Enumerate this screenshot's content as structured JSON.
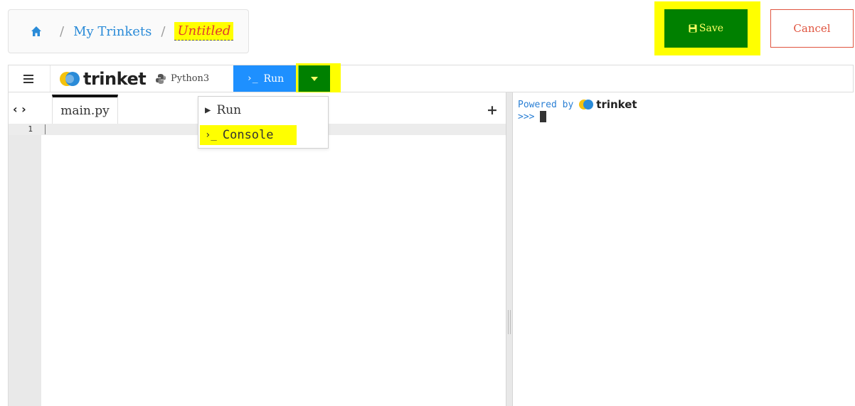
{
  "breadcrumb": {
    "home_icon": "home-icon",
    "separator": "/",
    "my_trinkets": "My Trinkets",
    "title": "Untitled"
  },
  "actions": {
    "save_label": "Save",
    "save_icon": "floppy-disk-icon",
    "cancel_label": "Cancel"
  },
  "toolbar": {
    "menu_icon": "hamburger-icon",
    "brand": "trinket",
    "language": "Python3",
    "run_prompt": "›_",
    "run_label": "Run",
    "dropdown_icon": "caret-down-icon"
  },
  "editor": {
    "code_toggle": "‹ ›",
    "file_tab": "main.py",
    "add_file": "+",
    "line_numbers": [
      "1"
    ]
  },
  "run_menu": {
    "items": [
      {
        "icon": "▶",
        "label": "Run"
      },
      {
        "icon": "›_",
        "label": "Console"
      }
    ]
  },
  "console": {
    "powered_by": "Powered by",
    "brand": "trinket",
    "prompt": ">>>"
  },
  "colors": {
    "highlight": "#ffff00",
    "save_bg": "#008000",
    "run_bg": "#1e90ff",
    "link": "#2a8bd8",
    "cancel": "#e0543f"
  }
}
